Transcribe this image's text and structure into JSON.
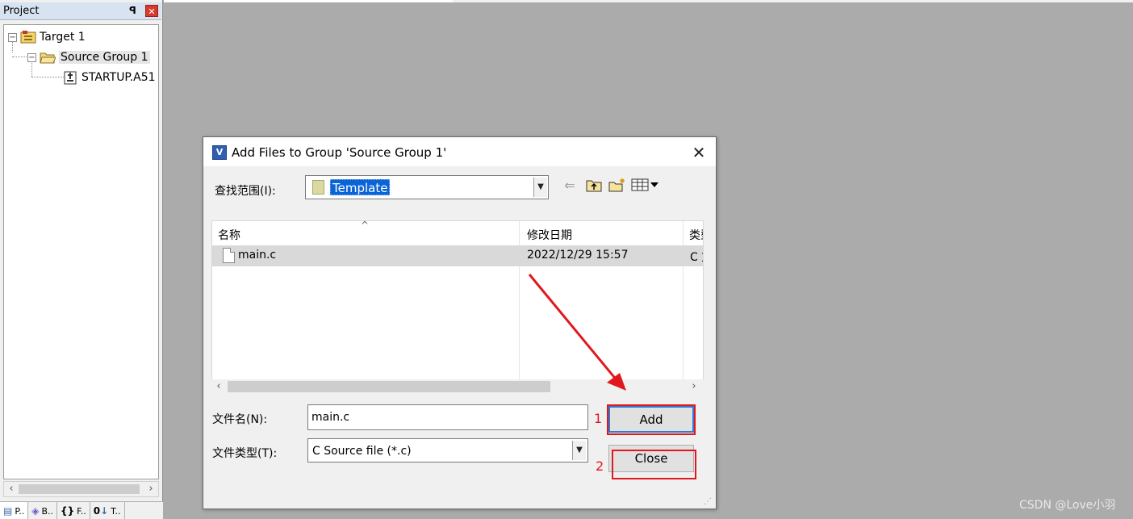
{
  "project_panel": {
    "title": "Project",
    "pin_glyph": "p",
    "close_glyph": "×",
    "tree": {
      "target": "Target 1",
      "group": "Source Group 1",
      "file": "STARTUP.A51"
    },
    "bottom_tabs": [
      {
        "icon": "project-icon",
        "label": "P.."
      },
      {
        "icon": "books-icon",
        "label": "B.."
      },
      {
        "icon": "functions-icon",
        "label": "F.."
      },
      {
        "icon": "templates-icon",
        "label": "T.."
      }
    ]
  },
  "dialog": {
    "title": "Add Files to Group 'Source Group 1'",
    "look_in_label": "查找范围(I):",
    "look_in_value": "Template",
    "file_list": {
      "columns": [
        "名称",
        "修改日期",
        "类型"
      ],
      "rows": [
        {
          "name": "main.c",
          "modified": "2022/12/29 15:57",
          "type": "C 文件"
        }
      ]
    },
    "filename_label": "文件名(N):",
    "filename_value": "main.c",
    "filetype_label": "文件类型(T):",
    "filetype_value": "C Source file (*.c)",
    "add_label": "Add",
    "close_label": "Close"
  },
  "annotations": {
    "step_1": "1",
    "step_2": "2",
    "arrow_color": "#e0181d"
  },
  "watermark": "CSDN @Love小羽",
  "colors": {
    "background": "#ababab",
    "selection": "#0a64d6",
    "annotation_red": "#e0181d"
  }
}
